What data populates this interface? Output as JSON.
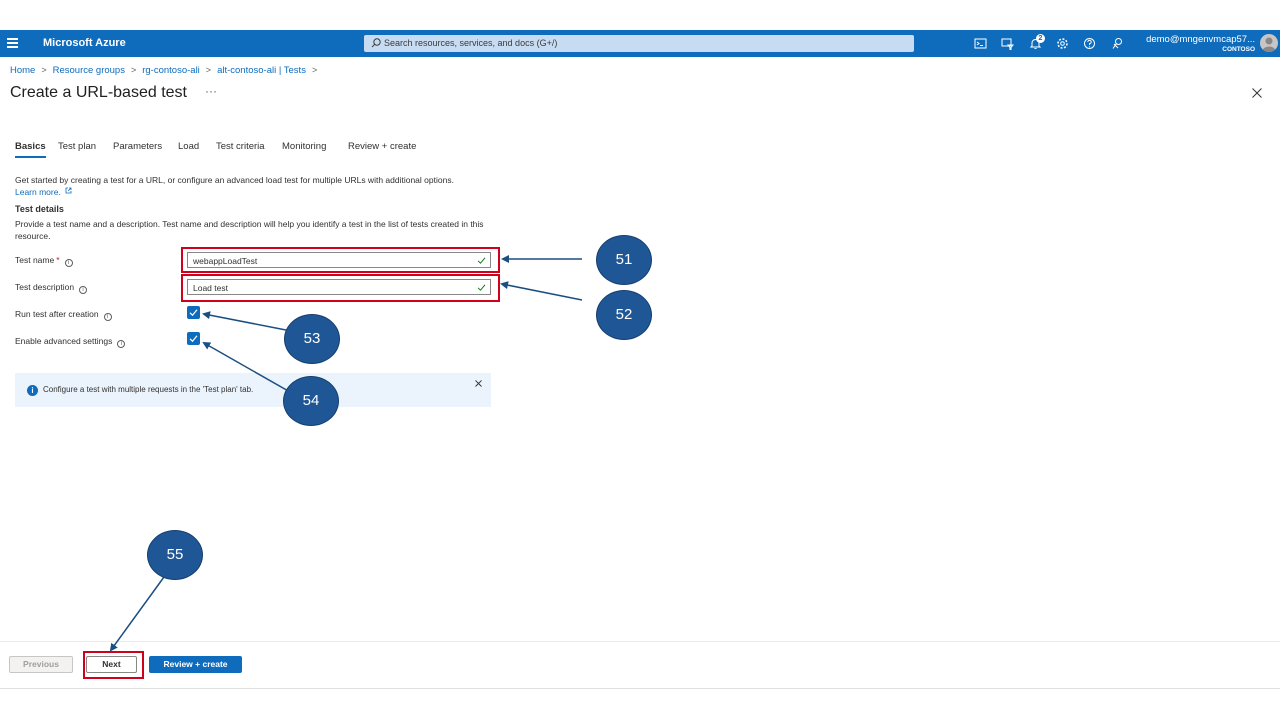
{
  "topbar": {
    "brand": "Microsoft Azure",
    "search_placeholder": "Search resources, services, and docs (G+/)",
    "notification_count": "2",
    "account_name": "demo@mngenvmcap57...",
    "account_tenant": "CONTOSO",
    "icons": [
      "cloud-shell-icon",
      "directory-filter-icon",
      "bell-icon",
      "gear-icon",
      "help-icon",
      "feedback-icon"
    ]
  },
  "breadcrumb": {
    "items": [
      "Home",
      "Resource groups",
      "rg-contoso-ali",
      "alt-contoso-ali | Tests"
    ],
    "separator": ">"
  },
  "page": {
    "title": "Create a URL-based test",
    "more": "···"
  },
  "tabs": [
    "Basics",
    "Test plan",
    "Parameters",
    "Load",
    "Test criteria",
    "Monitoring",
    "Review + create"
  ],
  "basics": {
    "intro": "Get started by creating a test for a URL, or configure an advanced load test for multiple URLs with additional options.",
    "learn_more": "Learn more.",
    "section_heading": "Test details",
    "section_desc": "Provide a test name and a description. Test name and description will help you identify a test in the list of tests created in this resource.",
    "test_name_label": "Test name",
    "required_mark": "*",
    "test_name_value": "webappLoadTest",
    "test_description_label": "Test description",
    "test_description_value": "Load test",
    "run_after_creation_label": "Run test after creation",
    "run_after_creation_checked": true,
    "enable_advanced_label": "Enable advanced settings",
    "enable_advanced_checked": true,
    "info_banner": "Configure a test with multiple requests in the 'Test plan' tab."
  },
  "callouts": [
    "51",
    "52",
    "53",
    "54",
    "55"
  ],
  "footer": {
    "previous": "Previous",
    "next": "Next",
    "review_create": "Review + create"
  },
  "colors": {
    "azure_blue": "#0f6cbd",
    "highlight_red": "#d0021b",
    "callout_blue": "#1f5796"
  }
}
